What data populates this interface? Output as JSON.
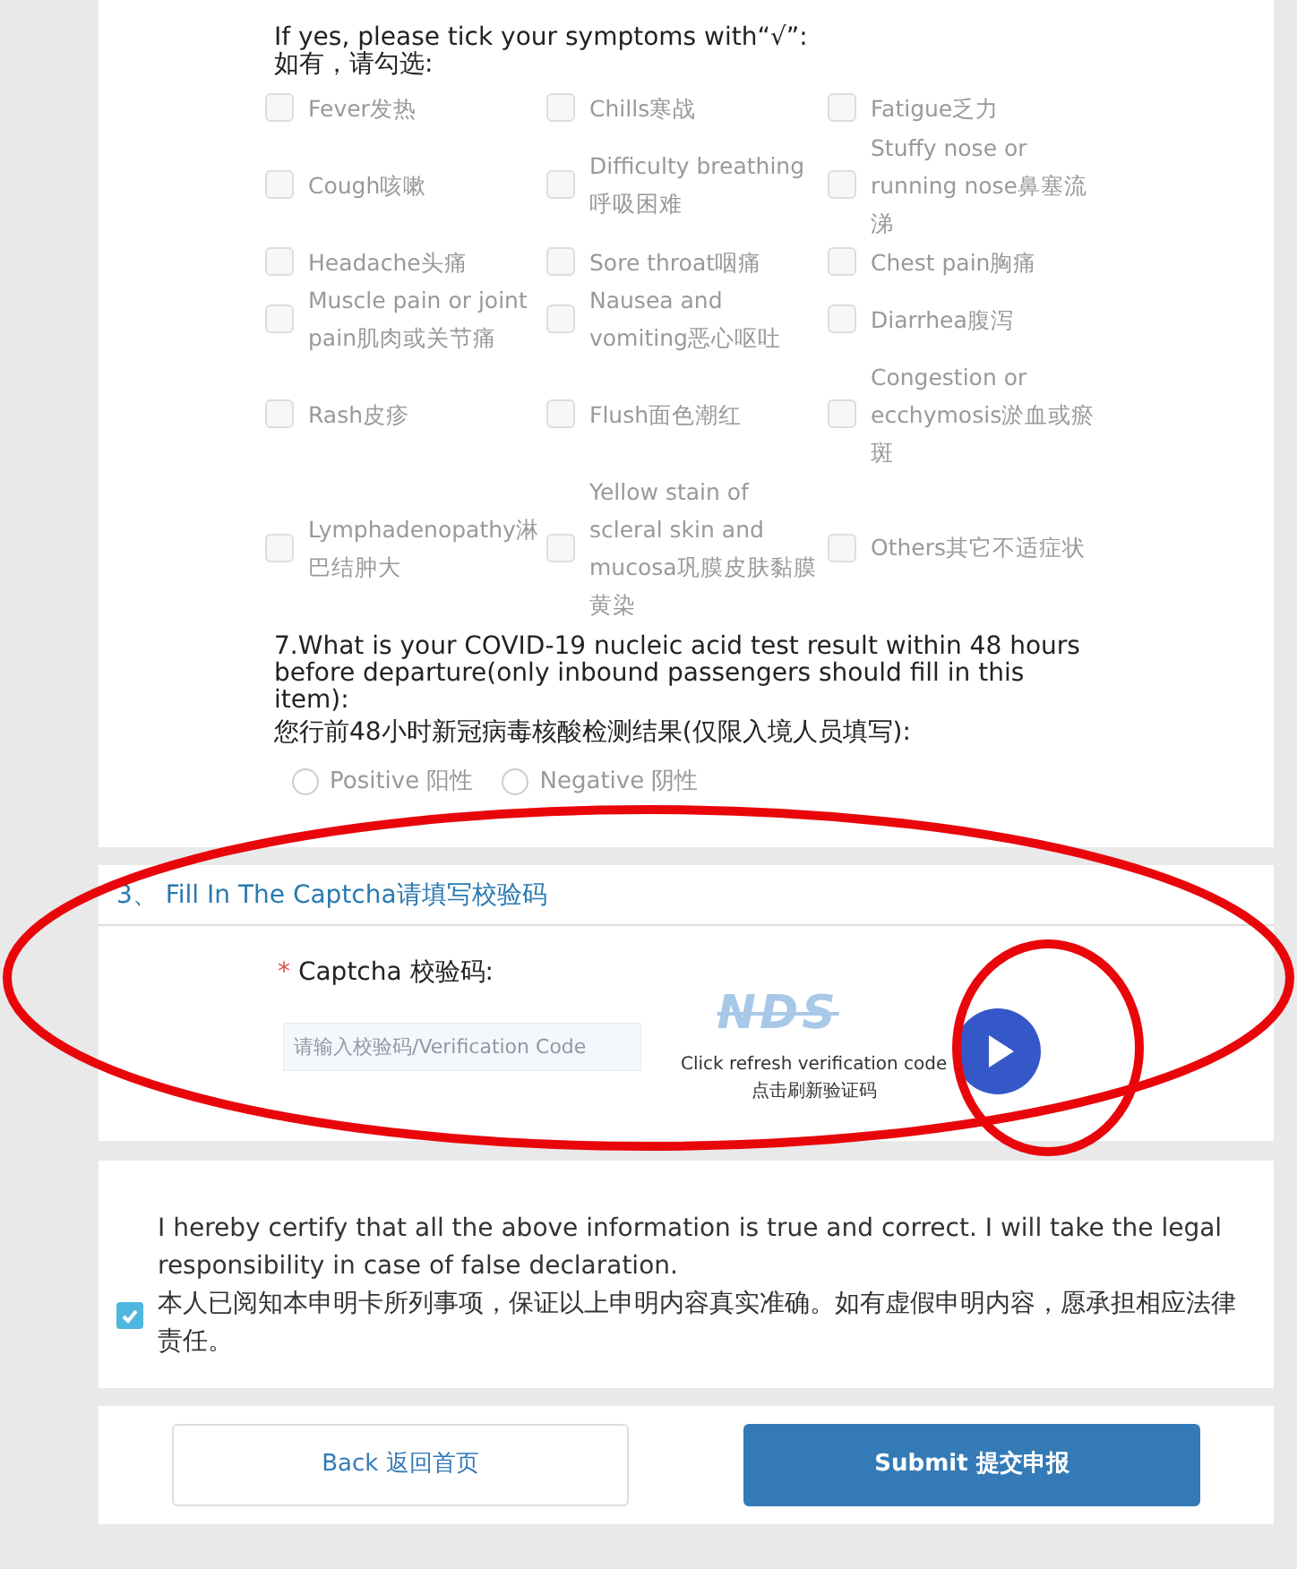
{
  "symptoms_prompt": {
    "en": "If yes, please tick your symptoms with“√”:",
    "zh": "如有，请勾选:"
  },
  "symptoms": [
    {
      "label": "Fever发热",
      "checked": false
    },
    {
      "label": "Chills寒战",
      "checked": false
    },
    {
      "label": "Fatigue乏力",
      "checked": false
    },
    {
      "label": "Cough咳嗽",
      "checked": false
    },
    {
      "label": "Difficulty breathing呼吸困难",
      "checked": false
    },
    {
      "label": "Stuffy nose or running nose鼻塞流涕",
      "checked": false
    },
    {
      "label": "Headache头痛",
      "checked": false
    },
    {
      "label": "Sore throat咽痛",
      "checked": false
    },
    {
      "label": "Chest pain胸痛",
      "checked": false
    },
    {
      "label": "Muscle pain or joint pain肌肉或关节痛",
      "checked": false
    },
    {
      "label": "Nausea and vomiting恶心呕吐",
      "checked": false
    },
    {
      "label": "Diarrhea腹泻",
      "checked": false
    },
    {
      "label": "Rash皮疹",
      "checked": false
    },
    {
      "label": "Flush面色潮红",
      "checked": false
    },
    {
      "label": "Congestion or ecchymosis淤血或瘀斑",
      "checked": false
    },
    {
      "label": "Lymphadenopathy淋巴结肿大",
      "checked": false
    },
    {
      "label": "Yellow stain of scleral skin and mucosa巩膜皮肤黏膜黄染",
      "checked": false
    },
    {
      "label": "Others其它不适症状",
      "checked": false
    }
  ],
  "test_question": {
    "en": "7.What is your COVID-19 nucleic acid test result within 48 hours before departure(only inbound passengers should fill in this item):",
    "zh": "您行前48小时新冠病毒核酸检测结果(仅限入境人员填写):"
  },
  "test_options": [
    {
      "label": "Positive 阳性",
      "selected": false
    },
    {
      "label": "Negative 阴性",
      "selected": false
    }
  ],
  "captcha_section": {
    "title": "3、 Fill In The Captcha请填写校验码",
    "required_mark": "*",
    "label": "Captcha 校验码:",
    "placeholder": "请输入校验码/Verification Code",
    "image_text": "NDS",
    "refresh_en": "Click refresh verification code",
    "refresh_zh": "点击刷新验证码"
  },
  "certification": {
    "checked": true,
    "en": "I hereby certify that all the above information is true and correct. I will take the legal responsibility in case of false declaration.",
    "zh": "本人已阅知本申明卡所列事项，保证以上申明内容真实准确。如有虚假申明内容，愿承担相应法律责任。"
  },
  "buttons": [
    {
      "label": "Back 返回首页",
      "kind": "secondary"
    },
    {
      "label": "Submit 提交申报",
      "kind": "primary"
    }
  ]
}
